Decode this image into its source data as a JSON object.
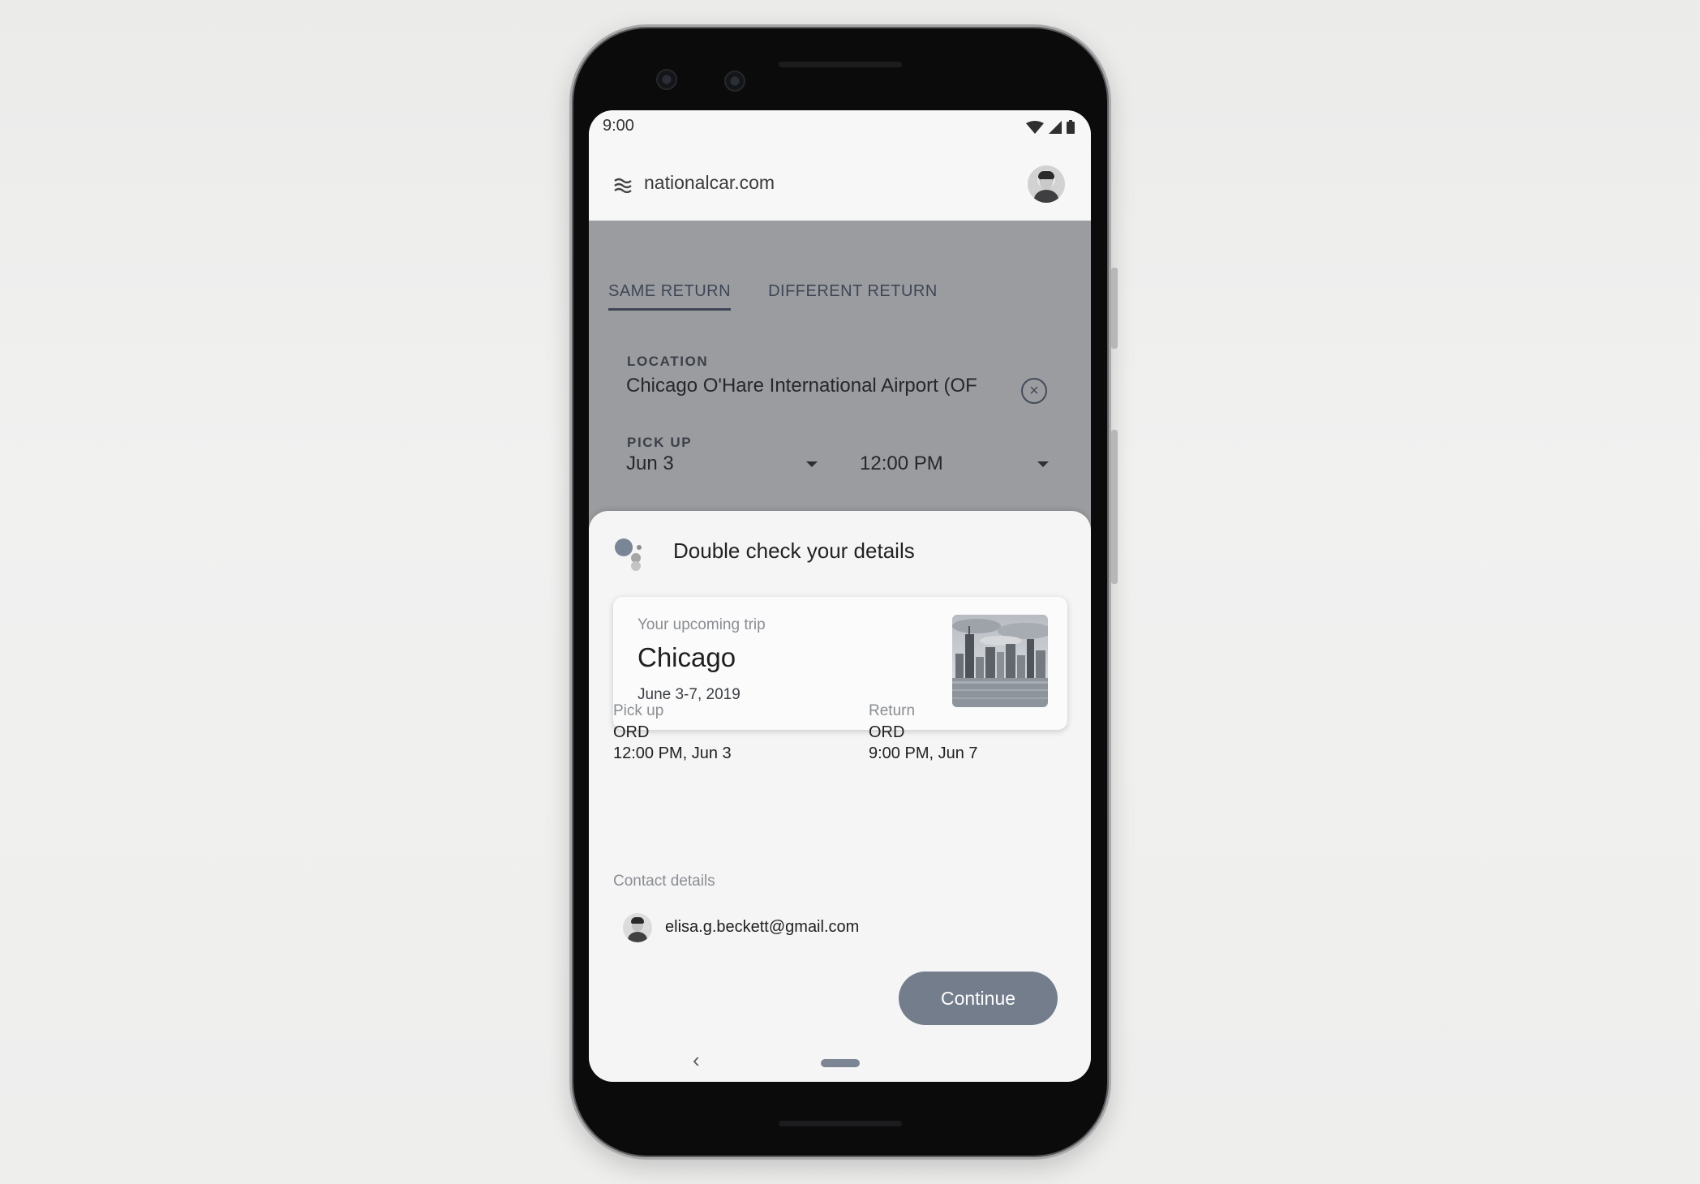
{
  "status_bar": {
    "time": "9:00"
  },
  "app_bar": {
    "site": "nationalcar.com"
  },
  "tabs": [
    {
      "label": "SAME RETURN",
      "active": true
    },
    {
      "label": "DIFFERENT RETURN",
      "active": false
    }
  ],
  "location": {
    "label": "LOCATION",
    "value": "Chicago O'Hare International Airport (OF"
  },
  "pickup": {
    "label": "PICK UP",
    "date": "Jun 3",
    "time": "12:00 PM"
  },
  "assistant": {
    "title": "Double check your details",
    "dot_colors": [
      "#7a8596",
      "#a6a6a6",
      "#c4c4c4",
      "#8d8d8d"
    ]
  },
  "trip": {
    "kicker": "Your upcoming trip",
    "city": "Chicago",
    "dates": "June 3-7, 2019"
  },
  "details": {
    "pickup": {
      "label": "Pick up",
      "code": "ORD",
      "time": "12:00 PM, Jun 3"
    },
    "return": {
      "label": "Return",
      "code": "ORD",
      "time": "9:00 PM, Jun 7"
    }
  },
  "contact": {
    "label": "Contact details",
    "email": "elisa.g.beckett@gmail.com"
  },
  "actions": {
    "continue_label": "Continue"
  },
  "nav": {
    "back_glyph": "‹"
  },
  "colors": {
    "accent": "#737d8c",
    "tab_text": "#3e4656",
    "dim_overlay": "#9b9c9f",
    "sheet_bg": "#f5f5f6"
  }
}
